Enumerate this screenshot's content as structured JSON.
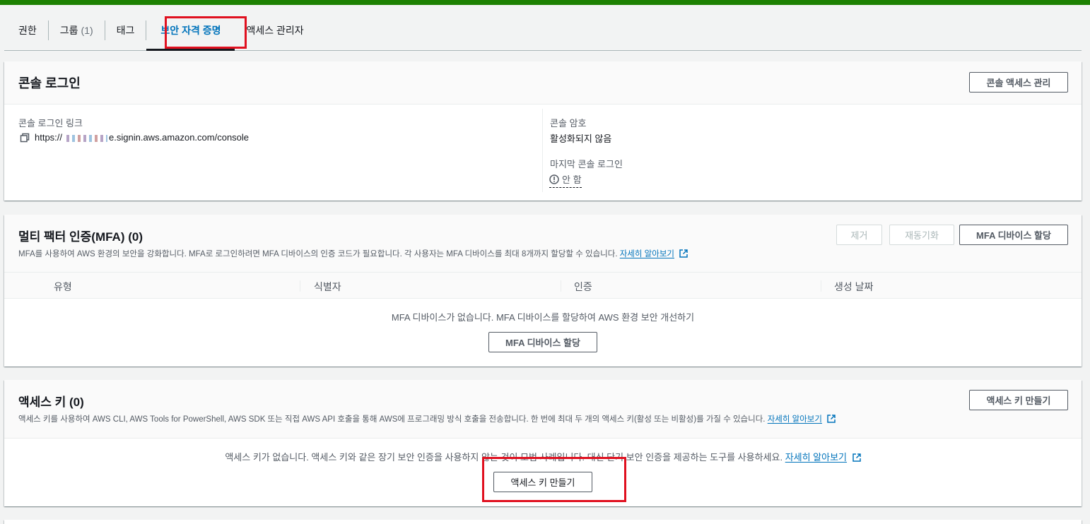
{
  "tabs": [
    {
      "label": "권한"
    },
    {
      "label": "그룹",
      "count": "(1)"
    },
    {
      "label": "태그"
    },
    {
      "label": "보안 자격 증명"
    },
    {
      "label": "액세스 관리자"
    }
  ],
  "console": {
    "title": "콘솔 로그인",
    "manage_button": "콘솔 액세스 관리",
    "link_label": "콘솔 로그인 링크",
    "link_prefix": "https://",
    "link_suffix": "e.signin.aws.amazon.com/console",
    "password_label": "콘솔 암호",
    "password_value": "활성화되지 않음",
    "last_login_label": "마지막 콘솔 로그인",
    "last_login_value": "안 함"
  },
  "mfa": {
    "title": "멀티 팩터 인증(MFA) (0)",
    "description": "MFA를 사용하여 AWS 환경의 보안을 강화합니다. MFA로 로그인하려면 MFA 디바이스의 인증 코드가 필요합니다. 각 사용자는 MFA 디바이스를 최대 8개까지 할당할 수 있습니다.",
    "learn_more": "자세히 알아보기",
    "remove_button": "제거",
    "resync_button": "재동기화",
    "assign_button": "MFA 디바이스 할당",
    "columns": [
      "유형",
      "식별자",
      "인증",
      "생성 날짜"
    ],
    "empty_text": "MFA 디바이스가 없습니다. MFA 디바이스를 할당하여 AWS 환경 보안 개선하기",
    "empty_button": "MFA 디바이스 할당"
  },
  "access_keys": {
    "title": "액세스 키 (0)",
    "description": "액세스 키를 사용하여 AWS CLI, AWS Tools for PowerShell, AWS SDK 또는 직접 AWS API 호출을 통해 AWS에 프로그래밍 방식 호출을 전송합니다. 한 번에 최대 두 개의 액세스 키(활성 또는 비활성)를 가질 수 있습니다.",
    "learn_more": "자세히 알아보기",
    "create_button": "액세스 키 만들기",
    "empty_text": "액세스 키가 없습니다. 액세스 키와 같은 장기 보안 인증을 사용하지 않는 것이 모범 사례입니다. 대신 단기 보안 인증을 제공하는 도구를 사용하세요.",
    "empty_learn_more": "자세히 알아보기",
    "empty_button": "액세스 키 만들기"
  },
  "colors": {
    "accent_green": "#1d8102",
    "link_blue": "#0073bb",
    "highlight_red": "#e0101f"
  }
}
